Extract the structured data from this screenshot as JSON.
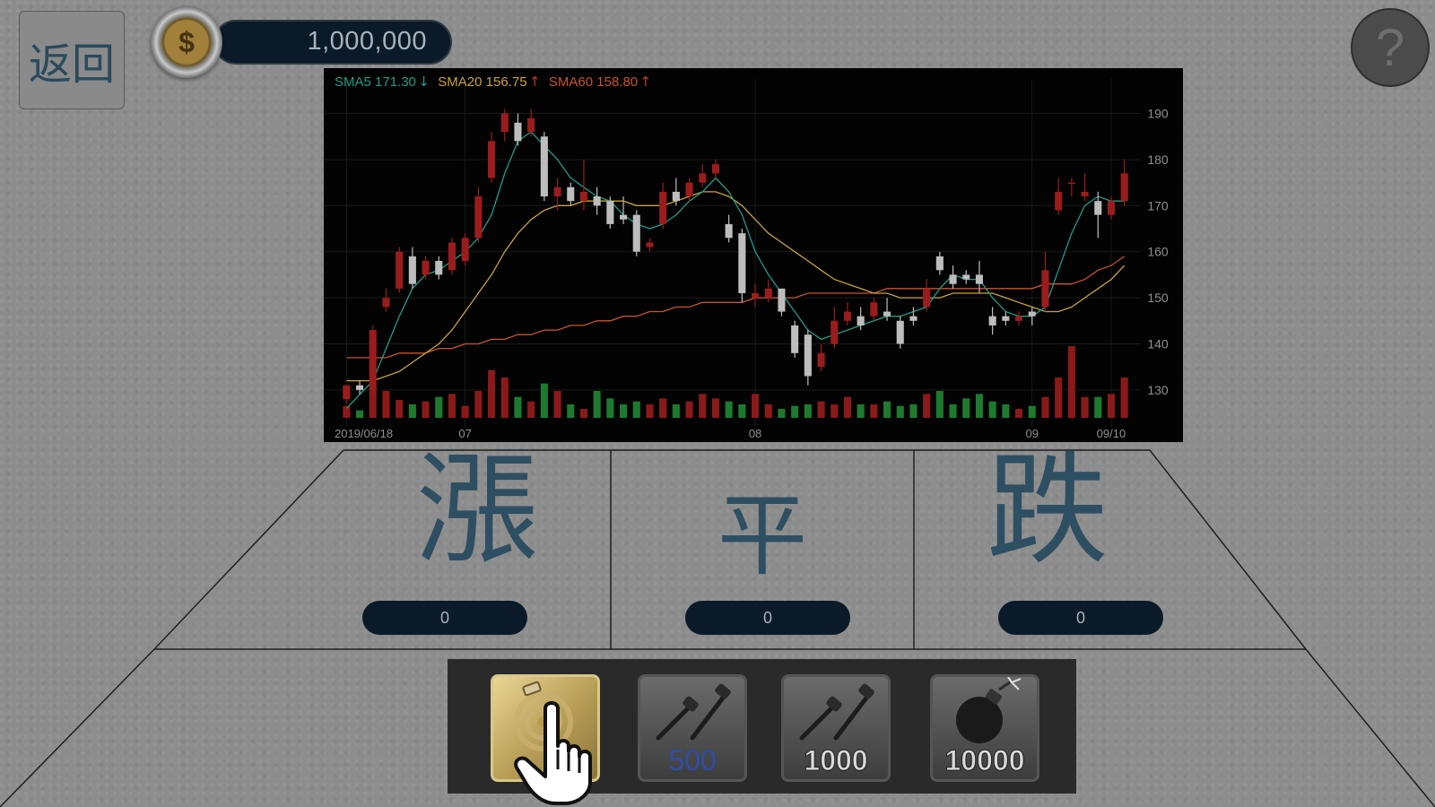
{
  "header": {
    "back_label": "返回",
    "coin_icon": "dollar-coin-icon",
    "coin_symbol": "$",
    "balance": "1,000,000",
    "help_label": "?"
  },
  "chart_data": {
    "type": "candlestick",
    "indicators": [
      {
        "label": "SMA5 171.30",
        "trend": "↓",
        "color": "#1f9b8b"
      },
      {
        "label": "SMA20 156.75",
        "trend": "↑",
        "color": "#c8a23a"
      },
      {
        "label": "SMA60 158.80",
        "trend": "↑",
        "color": "#c8532b"
      }
    ],
    "y_ticks": [
      190,
      180,
      170,
      160,
      150,
      140,
      130
    ],
    "ylim": [
      122,
      194
    ],
    "x_labels": [
      "2019/06/18",
      "07",
      "08",
      "09",
      "09/10"
    ],
    "x_label_index": [
      0,
      9,
      31,
      52,
      58
    ],
    "candles": [
      [
        128,
        131,
        127,
        131
      ],
      [
        131,
        130,
        129,
        132
      ],
      [
        130,
        143,
        129,
        144
      ],
      [
        148,
        150,
        147,
        152
      ],
      [
        152,
        160,
        151,
        161
      ],
      [
        159,
        153,
        152,
        161
      ],
      [
        155,
        158,
        154,
        159
      ],
      [
        158,
        155,
        154,
        159
      ],
      [
        156,
        162,
        155,
        163
      ],
      [
        158,
        163,
        157,
        164
      ],
      [
        163,
        172,
        162,
        174
      ],
      [
        176,
        184,
        175,
        186
      ],
      [
        186,
        190,
        184,
        191
      ],
      [
        188,
        184,
        183,
        190
      ],
      [
        186,
        189,
        185,
        191
      ],
      [
        185,
        172,
        171,
        186
      ],
      [
        172,
        174,
        169,
        176
      ],
      [
        174,
        171,
        170,
        175
      ],
      [
        171,
        173,
        169,
        180
      ],
      [
        172,
        170,
        168,
        174
      ],
      [
        171,
        166,
        165,
        172
      ],
      [
        168,
        167,
        166,
        172
      ],
      [
        168,
        160,
        159,
        169
      ],
      [
        161,
        162,
        160,
        163
      ],
      [
        166,
        173,
        165,
        175
      ],
      [
        173,
        171,
        170,
        176
      ],
      [
        172,
        175,
        171,
        176
      ],
      [
        175,
        177,
        174,
        179
      ],
      [
        177,
        179,
        176,
        180
      ],
      [
        166,
        163,
        162,
        168
      ],
      [
        164,
        151,
        149,
        165
      ],
      [
        150,
        151,
        148,
        153
      ],
      [
        150,
        152,
        149,
        154
      ],
      [
        152,
        147,
        146,
        152
      ],
      [
        144,
        138,
        137,
        145
      ],
      [
        142,
        133,
        131,
        143
      ],
      [
        135,
        138,
        134,
        140
      ],
      [
        140,
        145,
        139,
        148
      ],
      [
        145,
        147,
        144,
        149
      ],
      [
        146,
        144,
        143,
        148
      ],
      [
        146,
        149,
        145,
        150
      ],
      [
        147,
        146,
        145,
        150
      ],
      [
        145,
        140,
        139,
        146
      ],
      [
        146,
        145,
        144,
        148
      ],
      [
        148,
        152,
        147,
        154
      ],
      [
        159,
        156,
        155,
        160
      ],
      [
        155,
        153,
        152,
        157
      ],
      [
        155,
        154,
        153,
        156
      ],
      [
        155,
        153,
        151,
        158
      ],
      [
        146,
        144,
        142,
        148
      ],
      [
        146,
        145,
        144,
        147
      ],
      [
        145,
        146,
        144,
        147
      ],
      [
        147,
        146,
        144,
        148
      ],
      [
        148,
        156,
        147,
        160
      ],
      [
        169,
        173,
        168,
        176
      ],
      [
        175,
        175,
        172,
        176
      ],
      [
        172,
        173,
        171,
        177
      ],
      [
        171,
        168,
        163,
        173
      ],
      [
        168,
        171,
        167,
        172
      ],
      [
        171,
        177,
        170,
        180
      ]
    ],
    "volume": [
      8,
      5,
      20,
      18,
      12,
      9,
      11,
      14,
      16,
      8,
      18,
      32,
      27,
      14,
      11,
      23,
      18,
      9,
      6,
      18,
      13,
      9,
      11,
      9,
      13,
      9,
      11,
      16,
      13,
      11,
      9,
      16,
      9,
      6,
      8,
      9,
      11,
      9,
      14,
      9,
      9,
      11,
      8,
      9,
      16,
      18,
      9,
      13,
      16,
      11,
      9,
      6,
      8,
      14,
      27,
      48,
      14,
      14,
      16,
      27
    ],
    "sma5": [
      126,
      129,
      132,
      139,
      146,
      152,
      155,
      156,
      158,
      160,
      163,
      168,
      177,
      184,
      186,
      183,
      180,
      176,
      174,
      172,
      171,
      168,
      166,
      165,
      166,
      168,
      171,
      173,
      176,
      173,
      168,
      160,
      155,
      151,
      147,
      143,
      141,
      142,
      143,
      144,
      145,
      146,
      146,
      147,
      148,
      152,
      155,
      154,
      154,
      150,
      147,
      146,
      146,
      148,
      156,
      164,
      170,
      172,
      171,
      171
    ],
    "sma20": [
      132,
      132,
      132,
      133,
      134,
      136,
      138,
      140,
      143,
      147,
      151,
      155,
      160,
      164,
      167,
      169,
      170,
      170,
      171,
      171,
      171,
      171,
      170,
      170,
      170,
      171,
      172,
      173,
      173,
      172,
      170,
      167,
      164,
      162,
      160,
      158,
      156,
      154,
      153,
      152,
      151,
      151,
      150,
      150,
      150,
      150,
      151,
      151,
      151,
      151,
      150,
      149,
      148,
      147,
      147,
      148,
      150,
      152,
      154,
      157
    ],
    "sma60": [
      137,
      137,
      137,
      137,
      138,
      138,
      138,
      139,
      139,
      140,
      140,
      141,
      141,
      142,
      142,
      143,
      143,
      144,
      144,
      145,
      145,
      146,
      146,
      147,
      147,
      148,
      148,
      149,
      149,
      149,
      149,
      150,
      150,
      150,
      150,
      151,
      151,
      151,
      151,
      151,
      151,
      152,
      152,
      152,
      152,
      152,
      152,
      152,
      152,
      152,
      152,
      152,
      152,
      153,
      153,
      153,
      154,
      156,
      157,
      159
    ]
  },
  "bets": [
    {
      "label": "漲",
      "value": "0"
    },
    {
      "label": "平",
      "value": "0"
    },
    {
      "label": "跌",
      "value": "0"
    }
  ],
  "tools": [
    {
      "name": "tap-target-tool",
      "icon": "tap-target-icon",
      "label": "",
      "selected": true
    },
    {
      "name": "drill-500-tool",
      "icon": "drill-icon",
      "label": "500",
      "selected": false
    },
    {
      "name": "drill-1000-tool",
      "icon": "drill-icon",
      "label": "1000",
      "selected": false
    },
    {
      "name": "bomb-10000-tool",
      "icon": "bomb-icon",
      "label": "10000",
      "selected": false
    }
  ],
  "colors": {
    "up_candle": "#9b1c1c",
    "down_candle": "#bdbdbd",
    "volume_up": "#8a1a1a",
    "volume_down": "#1e7a2e",
    "axis_text": "#8f8f8f"
  }
}
